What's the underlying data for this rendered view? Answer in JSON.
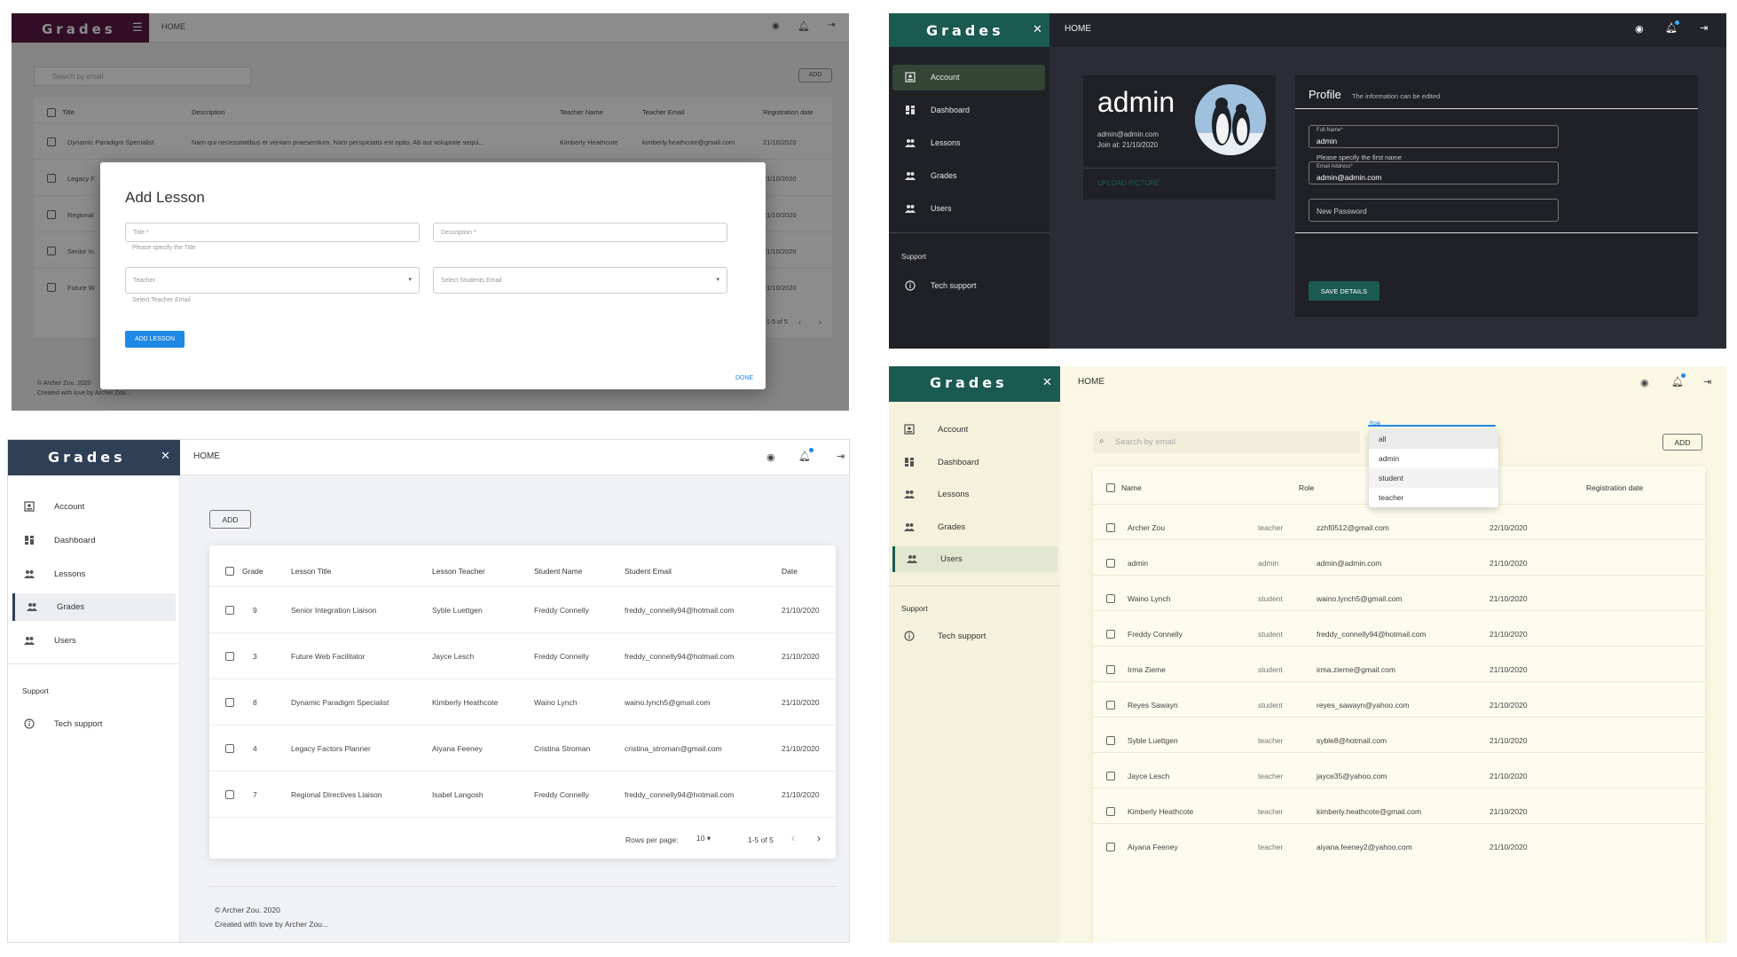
{
  "p1": {
    "brand": "Grades",
    "home": "HOME",
    "search_placeholder": "Search by email",
    "add": "ADD",
    "headers": [
      "Title",
      "Description",
      "Teacher Name",
      "Teacher Email",
      "Registration date"
    ],
    "rows": [
      [
        "Dynamic Paradigm Specialist",
        "Nam qui necessitatibus et veniam praesentium. Nam perspiciatis est optio. Ab aut voluptate sequi...",
        "Kimberly Heathcote",
        "kimberly.heathcote@gmail.com",
        "21/10/2020"
      ],
      [
        "Legacy F",
        "",
        "",
        "",
        "21/10/2020"
      ],
      [
        "Regional",
        "",
        "",
        "",
        "21/10/2020"
      ],
      [
        "Senior In",
        "",
        "",
        "",
        "21/10/2020"
      ],
      [
        "Future W",
        "",
        "",
        "",
        "21/10/2020"
      ]
    ],
    "pager": "1-5 of 5",
    "footer_line1": "© Archer Zou. 2020",
    "footer_line2": "Created with love by Archer Zou...",
    "dialog": {
      "title": "Add Lesson",
      "title_field": "Title *",
      "title_help": "Please specify the Title",
      "desc_field": "Description *",
      "teacher_field": "Teacher",
      "teacher_help": "Select Teacher Email",
      "students_field": "Select Students Email",
      "add_button": "ADD LESSON",
      "done": "DONE"
    },
    "colors": {
      "brand": "#5c1845",
      "accent": "#1e88e5"
    }
  },
  "p2": {
    "brand": "Grades",
    "home": "HOME",
    "nav": [
      "Account",
      "Dashboard",
      "Lessons",
      "Grades",
      "Users"
    ],
    "support_heading": "Support",
    "tech_support": "Tech support",
    "user_name": "admin",
    "user_email": "admin@admin.com",
    "join": "Join at: 21/10/2020",
    "upload": "UPLOAD PICTURE",
    "profile_title": "Profile",
    "profile_sub": "The information can be edited",
    "full_name_label": "Full Name*",
    "full_name_value": "admin",
    "full_name_help": "Please specify the first name",
    "email_label": "Email Address*",
    "email_value": "admin@admin.com",
    "password_placeholder": "New Password",
    "save": "SAVE DETAILS",
    "colors": {
      "brand": "#1a5a51",
      "bg": "#2a2d35"
    }
  },
  "p3": {
    "brand": "Grades",
    "home": "HOME",
    "nav": [
      "Account",
      "Dashboard",
      "Lessons",
      "Grades",
      "Users"
    ],
    "support_heading": "Support",
    "tech_support": "Tech support",
    "add": "ADD",
    "headers": [
      "Grade",
      "Lesson Title",
      "Lesson Teacher",
      "Student Name",
      "Student Email",
      "Date"
    ],
    "rows": [
      [
        "9",
        "Senior Integration Liaison",
        "Syble Luettgen",
        "Freddy Connelly",
        "freddy_connelly94@hotmail.com",
        "21/10/2020"
      ],
      [
        "3",
        "Future Web Facilitator",
        "Jayce Lesch",
        "Freddy Connelly",
        "freddy_connelly94@hotmail.com",
        "21/10/2020"
      ],
      [
        "8",
        "Dynamic Paradigm Specialist",
        "Kimberly Heathcote",
        "Waino Lynch",
        "waino.lynch5@gmail.com",
        "21/10/2020"
      ],
      [
        "4",
        "Legacy Factors Planner",
        "Aiyana Feeney",
        "Cristina Stroman",
        "cristina_stroman@gmail.com",
        "21/10/2020"
      ],
      [
        "7",
        "Regional Directives Liaison",
        "Isabel Langosh",
        "Freddy Connelly",
        "freddy_connelly94@hotmail.com",
        "21/10/2020"
      ]
    ],
    "rows_per_page_label": "Rows per page:",
    "rows_per_page": "10",
    "pager": "1-5 of 5",
    "footer_line1": "© Archer Zou. 2020",
    "footer_line2": "Created with love by Archer Zou...",
    "colors": {
      "brand": "#2f3f56"
    }
  },
  "p4": {
    "brand": "Grades",
    "home": "HOME",
    "nav": [
      "Account",
      "Dashboard",
      "Lessons",
      "Grades",
      "Users"
    ],
    "support_heading": "Support",
    "tech_support": "Tech support",
    "search_placeholder": "Search by email",
    "role_label": "Role",
    "role_options": [
      "all",
      "admin",
      "student",
      "teacher"
    ],
    "add": "ADD",
    "headers": [
      "Name",
      "Role",
      "Registration date"
    ],
    "rows": [
      [
        "Archer Zou",
        "teacher",
        "zzhf0512@gmail.com",
        "22/10/2020"
      ],
      [
        "admin",
        "admin",
        "admin@admin.com",
        "21/10/2020"
      ],
      [
        "Waino Lynch",
        "student",
        "waino.lynch5@gmail.com",
        "21/10/2020"
      ],
      [
        "Freddy Connelly",
        "student",
        "freddy_connelly94@hotmail.com",
        "21/10/2020"
      ],
      [
        "Irma Zieme",
        "student",
        "irma.zieme@gmail.com",
        "21/10/2020"
      ],
      [
        "Reyes Sawayn",
        "student",
        "reyes_sawayn@yahoo.com",
        "21/10/2020"
      ],
      [
        "Syble Luettgen",
        "teacher",
        "syble8@hotmail.com",
        "21/10/2020"
      ],
      [
        "Jayce Lesch",
        "teacher",
        "jayce35@yahoo.com",
        "21/10/2020"
      ],
      [
        "Kimberly Heathcote",
        "teacher",
        "kimberly.heathcote@gmail.com",
        "21/10/2020"
      ],
      [
        "Aiyana Feeney",
        "teacher",
        "aiyana.feeney2@yahoo.com",
        "21/10/2020"
      ]
    ],
    "colors": {
      "brand": "#1a5a51",
      "bg": "#faf7e4"
    }
  }
}
